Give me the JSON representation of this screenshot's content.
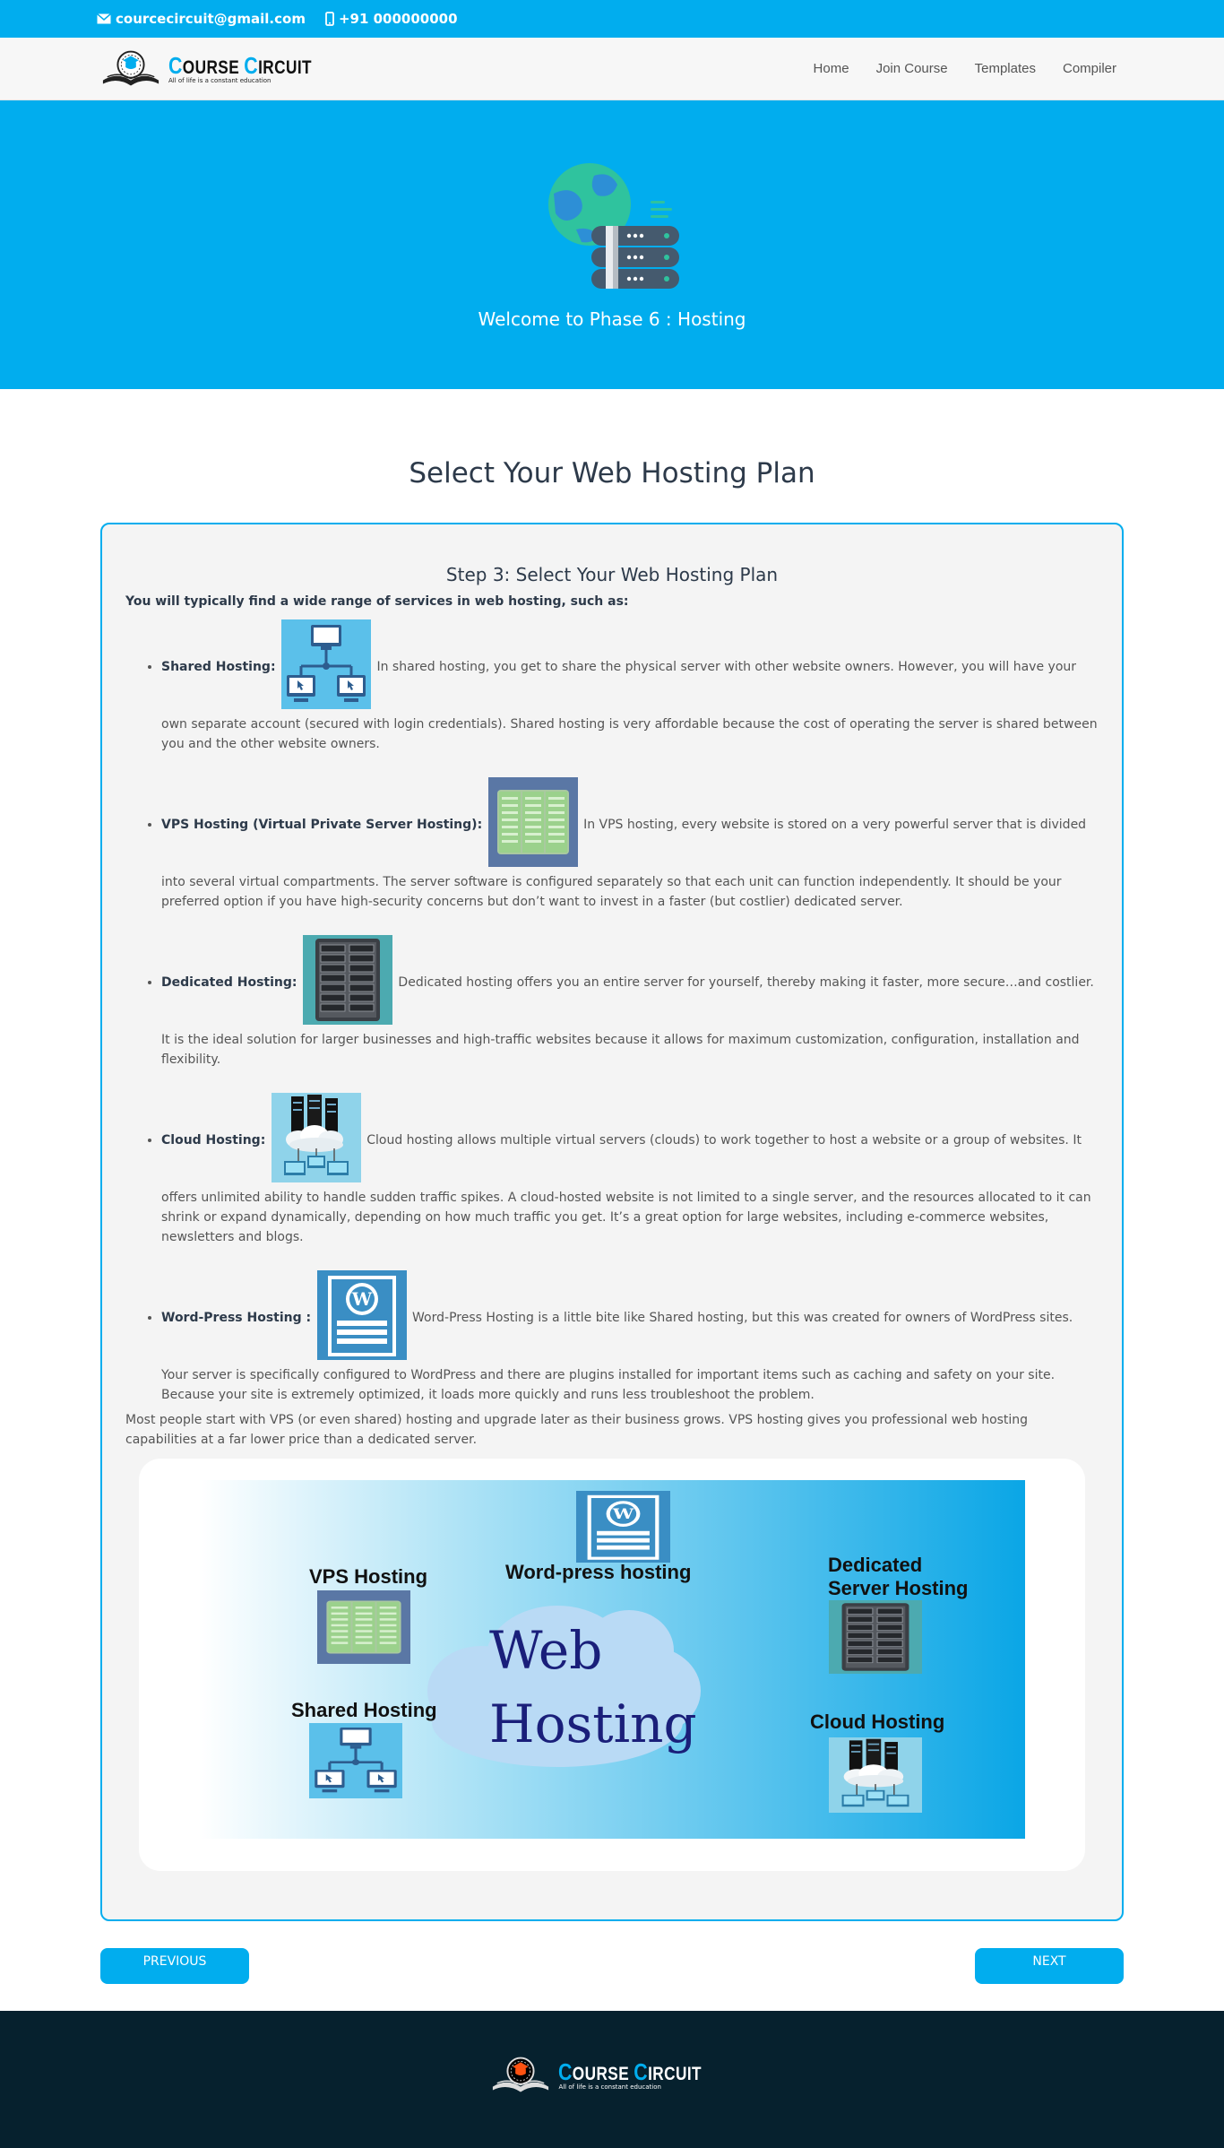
{
  "topbar": {
    "email": "courcecircuit@gmail.com",
    "phone": "+91 000000000",
    "email_icon": "envelope-icon",
    "phone_icon": "mobile-phone-icon"
  },
  "brand": {
    "title_c1": "C",
    "title_rest1": "OURSE ",
    "title_c2": "C",
    "title_rest2": "IRCUIT",
    "tagline": "All of life is a constant education"
  },
  "nav": {
    "items": [
      "Home",
      "Join Course",
      "Templates",
      "Compiler"
    ]
  },
  "hero": {
    "title": "Welcome to Phase 6 : Hosting",
    "icon": "globe-server-icon"
  },
  "main": {
    "section_title": "Select Your Web Hosting Plan",
    "step_title": "Step 3: Select Your Web Hosting Plan",
    "intro": "You will typically find a wide range of services in web hosting, such as:",
    "plans": [
      {
        "name": "Shared Hosting:",
        "icon": "shared-hosting-icon",
        "text": "In shared hosting, you get to share the physical server with other website owners. However, you will have your own separate account (secured with login credentials). Shared hosting is very affordable because the cost of operating the server is shared between you and the other website owners."
      },
      {
        "name": "VPS Hosting (Virtual Private Server Hosting):",
        "icon": "vps-hosting-icon",
        "text": "In VPS hosting, every website is stored on a very powerful server that is divided into several virtual compartments. The server software is configured separately so that each unit can function independently. It should be your preferred option if you have high-security concerns but don’t want to invest in a faster (but costlier) dedicated server."
      },
      {
        "name": "Dedicated Hosting:",
        "icon": "dedicated-hosting-icon",
        "text": "Dedicated hosting offers you an entire server for yourself, thereby making it faster, more secure…and costlier. It is the ideal solution for larger businesses and high-traffic websites because it allows for maximum customization, configuration, installation and flexibility."
      },
      {
        "name": "Cloud Hosting:",
        "icon": "cloud-hosting-icon",
        "text": "Cloud hosting allows multiple virtual servers (clouds) to work together to host a website or a group of websites. It offers unlimited ability to handle sudden traffic spikes. A cloud-hosted website is not limited to a single server, and the resources allocated to it can shrink or expand dynamically, depending on how much traffic you get. It’s a great option for large websites, including e-commerce websites, newsletters and blogs."
      },
      {
        "name": "Word-Press Hosting :",
        "icon": "wordpress-hosting-icon",
        "text": "Word-Press Hosting is a little bite like Shared hosting, but this was created for owners of WordPress sites. Your server is specifically configured to WordPress and there are plugins installed for important items such as caching and safety on your site. Because your site is extremely optimized, it loads more quickly and runs less troubleshoot the problem."
      }
    ],
    "outro": "Most people start with VPS (or even shared) hosting and upgrade later as their business grows. VPS hosting gives you professional web hosting capabilities at a far lower price than a dedicated server.",
    "banner": {
      "vps": "VPS Hosting",
      "wordpress": "Word-press hosting",
      "dedicated_line1": "Dedicated",
      "dedicated_line2": "Server Hosting",
      "shared": "Shared Hosting",
      "cloud": "Cloud Hosting",
      "web": "Web",
      "hosting": "Hosting"
    }
  },
  "buttons": {
    "previous": "PREVIOUS",
    "next": "NEXT"
  },
  "colors": {
    "accent": "#01adee",
    "footer": "#06212e"
  }
}
